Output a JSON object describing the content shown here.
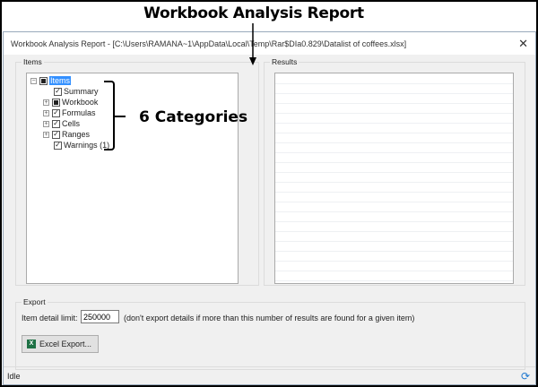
{
  "annotations": {
    "title": "Workbook Analysis Report",
    "categories": "6 Categories"
  },
  "window": {
    "title": "Workbook Analysis Report - [C:\\Users\\RAMANA~1\\AppData\\Local\\Temp\\Rar$DIa0.829\\Datalist of coffees.xlsx]",
    "close_icon": "close-icon"
  },
  "items": {
    "label": "Items",
    "tree": [
      {
        "label": "Items",
        "state": "partial",
        "expander": "minus",
        "selected": true
      },
      {
        "label": "Summary",
        "state": "checked"
      },
      {
        "label": "Workbook",
        "state": "partial",
        "expander": "plus"
      },
      {
        "label": "Formulas",
        "state": "checked",
        "expander": "plus"
      },
      {
        "label": "Cells",
        "state": "checked",
        "expander": "plus"
      },
      {
        "label": "Ranges",
        "state": "checked",
        "expander": "plus"
      },
      {
        "label": "Warnings (1)",
        "state": "checked"
      }
    ]
  },
  "results": {
    "label": "Results"
  },
  "export": {
    "label": "Export",
    "limit_label": "Item detail limit:",
    "limit_value": "250000",
    "limit_hint": "(don't export details if more than this number of results are found for a given item)",
    "button_label": "Excel Export..."
  },
  "status": {
    "text": "Idle",
    "icon": "refresh-icon"
  }
}
